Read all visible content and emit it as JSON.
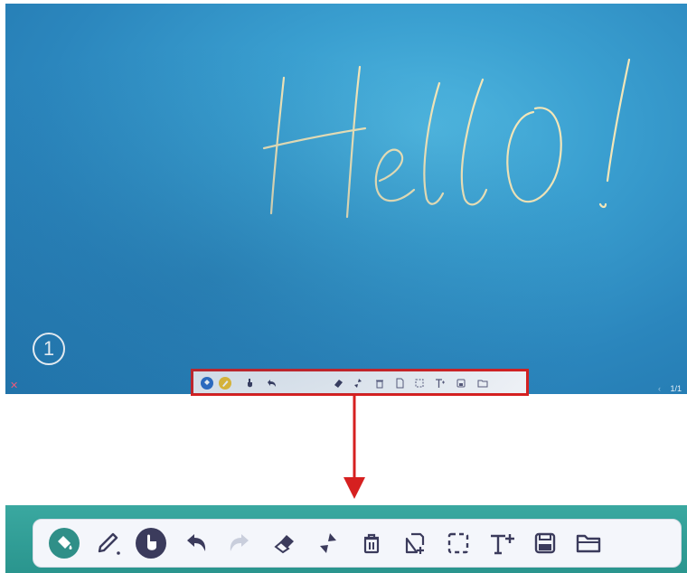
{
  "board": {
    "handwriting": "Hello!",
    "step_number": "1",
    "close_symbol": "✕",
    "prev_symbol": "‹",
    "page_indicator": "1/1"
  },
  "colors": {
    "board_blue": "#3aa0d2",
    "highlight_red": "#d62020",
    "toolbar_bg": "#f4f6fb",
    "icon_dark": "#3b3b5c",
    "icon_teal": "#2f8f88",
    "pen_yellow": "#f2c12e",
    "strip_teal": "#2f9e97"
  },
  "toolbar": {
    "tools": [
      {
        "name": "paint-bucket-icon",
        "state": "active"
      },
      {
        "name": "pen-icon",
        "state": "normal"
      },
      {
        "name": "hand-pointer-icon",
        "state": "normal"
      },
      {
        "name": "undo-icon",
        "state": "normal"
      },
      {
        "name": "redo-icon",
        "state": "disabled"
      },
      {
        "name": "eraser-icon",
        "state": "normal"
      },
      {
        "name": "shrink-icon",
        "state": "normal"
      },
      {
        "name": "trash-icon",
        "state": "normal"
      },
      {
        "name": "new-page-icon",
        "state": "normal"
      },
      {
        "name": "select-icon",
        "state": "normal"
      },
      {
        "name": "text-icon",
        "state": "normal"
      },
      {
        "name": "save-icon",
        "state": "normal"
      },
      {
        "name": "folder-icon",
        "state": "normal"
      }
    ]
  }
}
